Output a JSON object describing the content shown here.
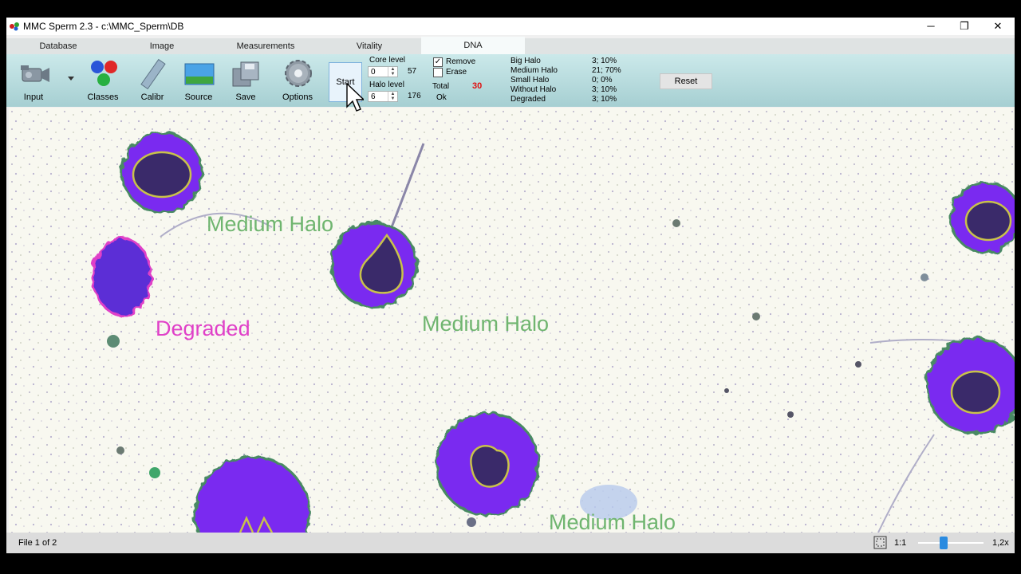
{
  "window": {
    "title": "MMC Sperm 2.3 - c:\\MMC_Sperm\\DB",
    "controls": {
      "minimize": "─",
      "restore": "❐",
      "close": "✕"
    }
  },
  "tabs": [
    {
      "label": "Database"
    },
    {
      "label": "Image"
    },
    {
      "label": "Measurements"
    },
    {
      "label": "Vitality"
    },
    {
      "label": "DNA",
      "active": true
    }
  ],
  "toolbar": {
    "input_label": "Input",
    "classes_label": "Classes",
    "calibr_label": "Calibr",
    "source_label": "Source",
    "save_label": "Save",
    "options_label": "Options",
    "start_label": "Start"
  },
  "levels": {
    "core_label": "Core level",
    "core_value": "0",
    "core_readout": "57",
    "halo_label": "Halo level",
    "halo_value": "6",
    "halo_readout": "176"
  },
  "options": {
    "remove_label": "Remove",
    "remove_checked": true,
    "erase_label": "Erase",
    "erase_checked": false
  },
  "total": {
    "label": "Total",
    "value": "30",
    "status": "Ok"
  },
  "stats": [
    {
      "name": "Big Halo",
      "value": "3; 10%"
    },
    {
      "name": "Medium Halo",
      "value": "21; 70%"
    },
    {
      "name": "Small Halo",
      "value": "0; 0%"
    },
    {
      "name": "Without Halo",
      "value": "3; 10%"
    },
    {
      "name": "Degraded",
      "value": "3; 10%"
    }
  ],
  "reset_label": "Reset",
  "image_labels": {
    "label1": "Medium Halo",
    "label2": "Medium Halo",
    "label3": "Medium Halo",
    "label4": "Degraded"
  },
  "colors": {
    "medium_halo": "#6fb56f",
    "degraded": "#e040c8",
    "total_value": "#e01010",
    "halo_fill": "#7a2cf0",
    "core_outline": "#c9c24a"
  },
  "status": {
    "file_text": "File 1 of 2",
    "scale_label": "1:1",
    "zoom": "1,2x"
  }
}
